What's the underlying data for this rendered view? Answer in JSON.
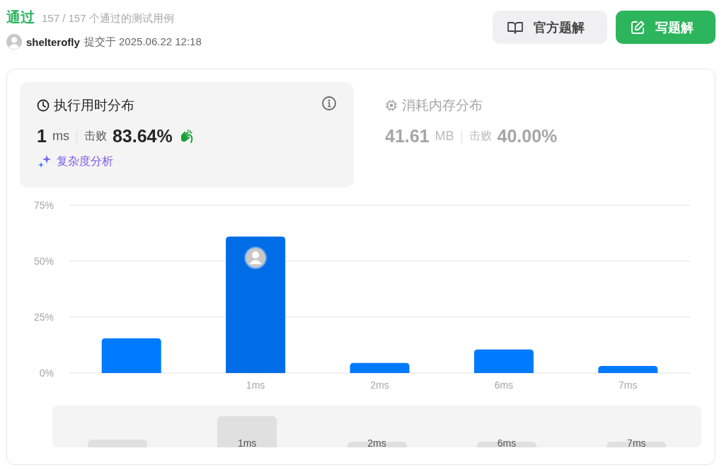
{
  "status": "通过",
  "testcases": "157 / 157 个通过的测试用例",
  "submitter": {
    "name": "shelterofly",
    "submitted": "提交于 2025.06.22 12:18"
  },
  "buttons": [
    {
      "label": "官方题解",
      "kind": "secondary"
    },
    {
      "label": "写题解",
      "kind": "primary"
    }
  ],
  "panels": [
    {
      "kind": "runtime",
      "title": "执行用时分布",
      "value": "1",
      "unit": "ms",
      "beats_label": "击败",
      "beats": "83.64%",
      "link": "复杂度分析",
      "selected": true
    },
    {
      "kind": "memory",
      "title": "消耗内存分布",
      "value": "41.61",
      "unit": "MB",
      "beats_label": "击败",
      "beats": "40.00%",
      "selected": false
    }
  ],
  "distribution": {
    "chart_data": {
      "type": "bar",
      "categories": [
        null,
        "1ms",
        "2ms",
        "6ms",
        "7ms"
      ],
      "values": [
        15.5,
        61,
        4.5,
        10.5,
        3.2
      ],
      "ylim": [
        0,
        75
      ],
      "yticks": [
        {
          "value": 0,
          "label": "0%"
        },
        {
          "value": 25,
          "label": "25%"
        },
        {
          "value": 50,
          "label": "50%"
        },
        {
          "value": 75,
          "label": "75%"
        }
      ]
    },
    "bars": [
      {
        "selected": false
      },
      {
        "label": "1ms",
        "selected": true
      },
      {
        "label": "2ms",
        "selected": false
      },
      {
        "label": "6ms",
        "selected": false
      },
      {
        "label": "7ms",
        "selected": false
      }
    ]
  }
}
